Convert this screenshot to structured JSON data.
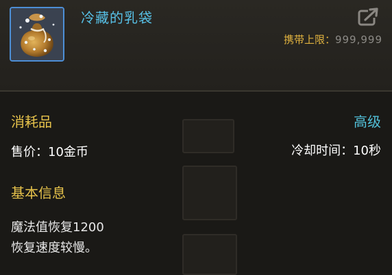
{
  "item": {
    "name": "冷藏的乳袋",
    "icon": "milk-pouch-icon",
    "carry_limit_label": "携带上限：",
    "carry_limit_value": "999,999",
    "share_icon": "share-export-icon"
  },
  "details": {
    "category": "消耗品",
    "grade": "高级",
    "price_label": "售价：",
    "price_value": "10金币",
    "cooldown_label": "冷却时间：",
    "cooldown_value": "10秒"
  },
  "basic_info": {
    "title": "基本信息",
    "lines": [
      "魔法值恢复1200",
      "恢复速度较慢。"
    ]
  },
  "colors": {
    "name": "#57c0e6",
    "gold": "#e6c24b",
    "grade": "#52c0d9",
    "frame": "#4d8fd6"
  }
}
